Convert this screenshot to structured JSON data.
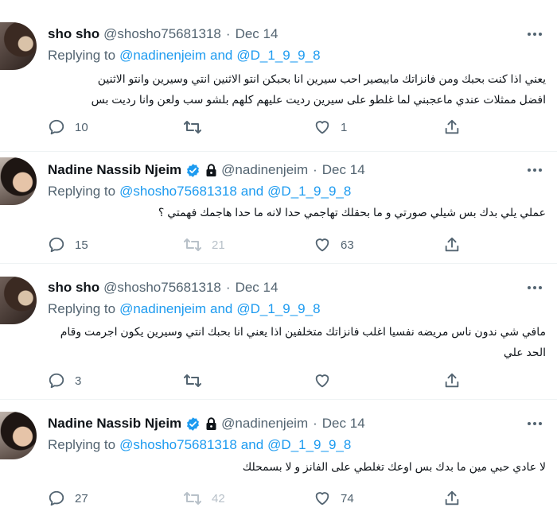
{
  "tweets": [
    {
      "name": "sho sho",
      "handle": "@shosho75681318",
      "date": "Dec 14",
      "replying_prefix": "Replying to",
      "reply_user1": "@nadinenjeim",
      "reply_and": "and",
      "reply_user2": "@D_1_9_9_8",
      "text_line1": "يعني اذا كنت بحبك ومن فانزاتك مابيصير احب سيرين انا بحبكن انتو الاثنين انتي وسيرين وانتو الاثنين",
      "text_line2": "افضل ممثلات عندي ماعجبني لما غلطو على سيرين رديت عليهم  كلهم بلشو سب ولعن وانا رديت بس",
      "replies": "10",
      "retweets": "",
      "likes": "1",
      "verified": false,
      "protected": false
    },
    {
      "name": "Nadine Nassib Njeim",
      "handle": "@nadinenjeim",
      "date": "Dec 14",
      "replying_prefix": "Replying to",
      "reply_user1": "@shosho75681318",
      "reply_and": "and",
      "reply_user2": "@D_1_9_9_8",
      "text_line1": "عملي يلي بدك بس شيلي صورتي و ما بحقلك تهاجمي حدا لانه ما حدا هاجمك فهمتي ؟",
      "text_line2": "",
      "replies": "15",
      "retweets": "21",
      "likes": "63",
      "verified": true,
      "protected": true
    },
    {
      "name": "sho sho",
      "handle": "@shosho75681318",
      "date": "Dec 14",
      "replying_prefix": "Replying to",
      "reply_user1": "@nadinenjeim",
      "reply_and": "and",
      "reply_user2": "@D_1_9_9_8",
      "text_line1": "مافي شي ندون ناس مريضه  نفسيا اغلب فانزاتك متخلفين اذا يعني انا بحبك انتي وسيرين يكون اجرمت وقام",
      "text_line2": "الحد علي",
      "replies": "3",
      "retweets": "",
      "likes": "",
      "verified": false,
      "protected": false
    },
    {
      "name": "Nadine Nassib Njeim",
      "handle": "@nadinenjeim",
      "date": "Dec 14",
      "replying_prefix": "Replying to",
      "reply_user1": "@shosho75681318",
      "reply_and": "and",
      "reply_user2": "@D_1_9_9_8",
      "text_line1": "لا عادي حبي مين ما بدك بس اوعك تغلطي على الفانز و لا بسمحلك",
      "text_line2": "",
      "replies": "27",
      "retweets": "42",
      "likes": "74",
      "verified": true,
      "protected": true
    }
  ],
  "icons": {
    "reply": "reply-icon",
    "retweet": "retweet-icon",
    "like": "heart-icon",
    "share": "share-icon",
    "more": "more-icon",
    "verified": "verified-badge-icon",
    "lock": "lock-icon"
  },
  "colors": {
    "link": "#1d9bf0",
    "secondary_text": "#536471",
    "verified": "#1d9bf0"
  }
}
